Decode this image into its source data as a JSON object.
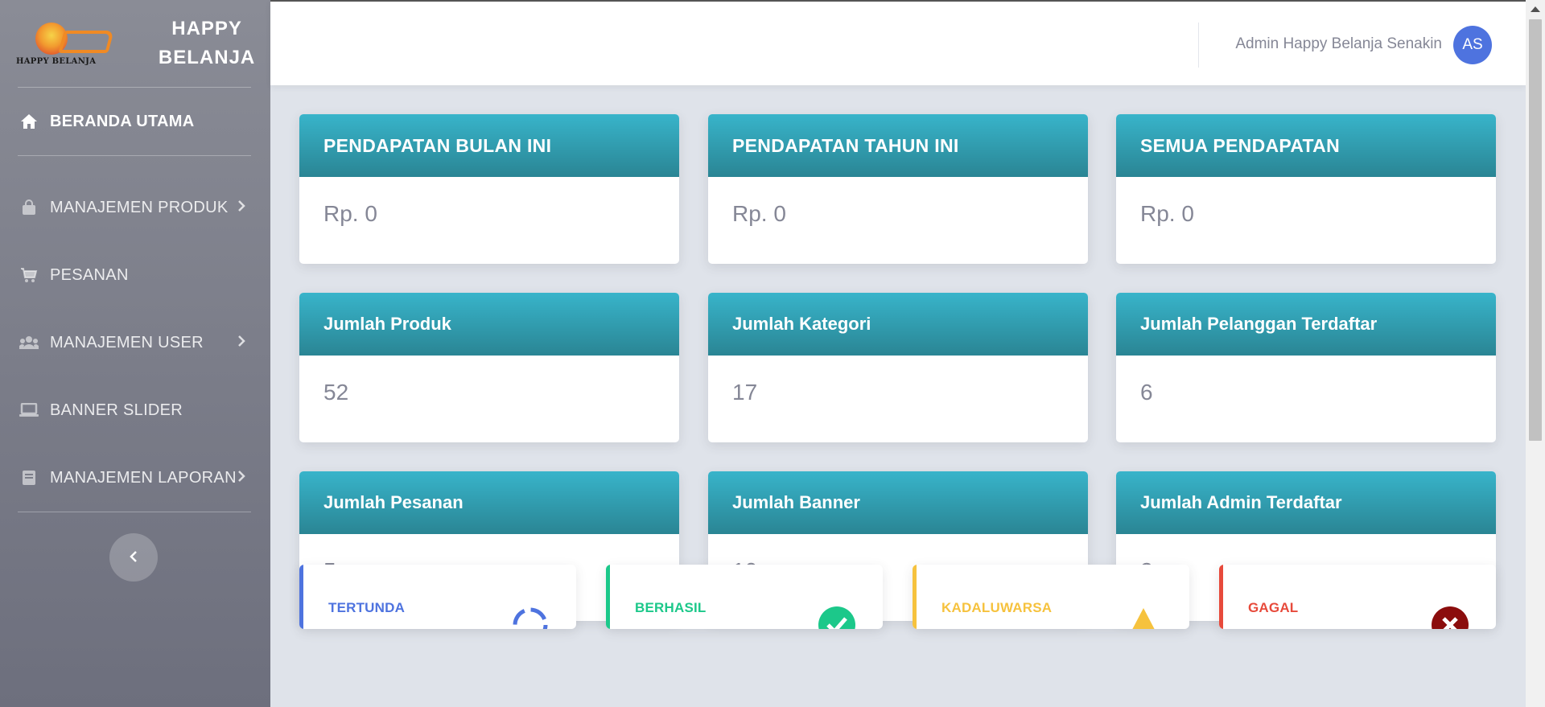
{
  "brand": {
    "name_line1": "HAPPY",
    "name_line2": "BELANJA",
    "logo_text": "HAPPY BELANJA"
  },
  "sidebar": {
    "items": [
      {
        "label": "BERANDA UTAMA",
        "icon": "home-icon",
        "active": true,
        "has_submenu": false
      },
      {
        "label": "MANAJEMEN PRODUK",
        "icon": "bag-icon",
        "active": false,
        "has_submenu": true
      },
      {
        "label": "PESANAN",
        "icon": "cart-icon",
        "active": false,
        "has_submenu": false
      },
      {
        "label": "MANAJEMEN USER",
        "icon": "users-icon",
        "active": false,
        "has_submenu": true
      },
      {
        "label": "BANNER SLIDER",
        "icon": "laptop-icon",
        "active": false,
        "has_submenu": false
      },
      {
        "label": "MANAJEMEN LAPORAN",
        "icon": "book-icon",
        "active": false,
        "has_submenu": true
      }
    ],
    "toggle_icon": "chevron-left-icon"
  },
  "topbar": {
    "user_name": "Admin Happy Belanja Senakin",
    "avatar_initials": "AS",
    "avatar_color": "#4e73df"
  },
  "stats": {
    "revenue": [
      {
        "title": "PENDAPATAN BULAN INI",
        "value": "Rp. 0"
      },
      {
        "title": "PENDAPATAN TAHUN INI",
        "value": "Rp. 0"
      },
      {
        "title": "SEMUA PENDAPATAN",
        "value": "Rp. 0"
      }
    ],
    "counts_row1": [
      {
        "title": "Jumlah Produk",
        "value": "52"
      },
      {
        "title": "Jumlah Kategori",
        "value": "17"
      },
      {
        "title": "Jumlah Pelanggan Terdaftar",
        "value": "6"
      }
    ],
    "counts_row2": [
      {
        "title": "Jumlah Pesanan",
        "value": "5"
      },
      {
        "title": "Jumlah Banner",
        "value": "10"
      },
      {
        "title": "Jumlah Admin Terdaftar",
        "value": "2"
      }
    ]
  },
  "order_status": [
    {
      "label": "TERTUNDA",
      "color": "#4e73df",
      "icon": "spinner-icon"
    },
    {
      "label": "BERHASIL",
      "color": "#1cc88a",
      "icon": "check-circle-icon"
    },
    {
      "label": "KADALUWARSA",
      "color": "#f6c23e",
      "icon": "warning-icon"
    },
    {
      "label": "GAGAL",
      "color": "#e74a3b",
      "icon": "x-circle-icon"
    }
  ],
  "colors": {
    "card_header_top": "#38b4ca",
    "card_header_bottom": "#2a8594",
    "sidebar_top": "#8a8c96",
    "sidebar_bottom": "#6d6f7d"
  }
}
